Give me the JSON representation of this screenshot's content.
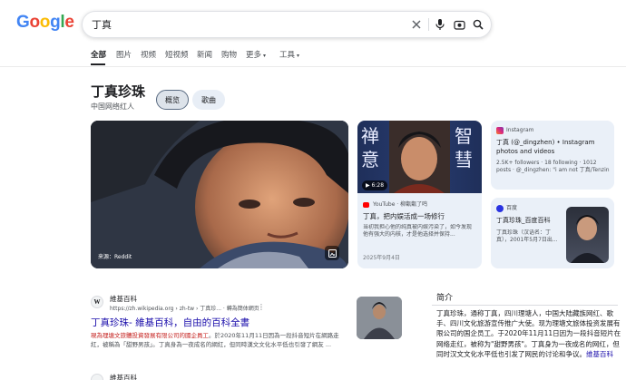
{
  "logo": {
    "letters": [
      "G",
      "o",
      "o",
      "g",
      "l",
      "e"
    ]
  },
  "search": {
    "query": "丁真"
  },
  "tabs": [
    {
      "label": "全部",
      "active": true
    },
    {
      "label": "图片"
    },
    {
      "label": "视频"
    },
    {
      "label": "短视频"
    },
    {
      "label": "新闻"
    },
    {
      "label": "购物"
    },
    {
      "label": "更多"
    },
    {
      "label": "工具"
    }
  ],
  "entity": {
    "title": "丁真珍珠",
    "subtitle": "中国网络红人",
    "chips": [
      "概览",
      "歌曲"
    ]
  },
  "main_image": {
    "source": "来源：Reddit"
  },
  "video_card": {
    "thumb_chars_left": [
      "禅",
      "意"
    ],
    "thumb_chars_right": [
      "智",
      "彗"
    ],
    "duration": "6:28",
    "source": "YouTube · 柳甑甑了鸣",
    "title": "丁真，把内娱活成一场修行",
    "snippet": "当初我担心他的纯真被内娱污染了，如今发现他有强大的内核，才是他选择并保持...",
    "date": "2025年9月4日"
  },
  "instagram_card": {
    "source": "Instagram",
    "title": "丁真 (@_dingzhen) • Instagram photos and videos",
    "meta": "2.5K+ followers · 18 following · 1012 posts · @_dingzhen: \"i am not 丁真/Tenzin • (FA..."
  },
  "baidu_card": {
    "source": "百度",
    "title": "丁真珍珠_百度百科",
    "snippet": "丁真珍珠（汉语名：丁真），2001年5月7日出..."
  },
  "result": {
    "site": "維基百科",
    "url": "https://zh.wikipedia.org › zh-tw › 丁真珍... · 轉為簡体網页",
    "title": "丁真珍珠- 維基百科，自由的百科全書",
    "snippet_highlight": "現為理塘文旅體投資發展有限公司的國企員工",
    "snippet_rest": "。於2020年11月11日因為一段抖音短片在網路走紅，被稱為「甜野男孩」。丁真身為一夜成名的網紅，但同時漢文文化水平低也引發了網友 ..."
  },
  "result2": {
    "site": "維基百科"
  },
  "sidebar": {
    "heading": "简介",
    "text": "丁真珍珠，通称丁真，四川理塘人，中国大陆藏族网红、歌手、四川文化旅游宣传推广大使。现为理塘文旅体投资发展有限公司的国企员工。于2020年11月11日因为一段抖音短片在网络走红，被称为\"甜野男孩\"。丁真身为一夜成名的网红，但同时汉文文化水平低也引发了网民的讨论和争议。",
    "link": "维基百科"
  },
  "colors": {
    "google_blue": "#4285f4",
    "google_red": "#ea4335",
    "google_yellow": "#fbbc05",
    "google_green": "#34a853",
    "link": "#1a0dab"
  }
}
